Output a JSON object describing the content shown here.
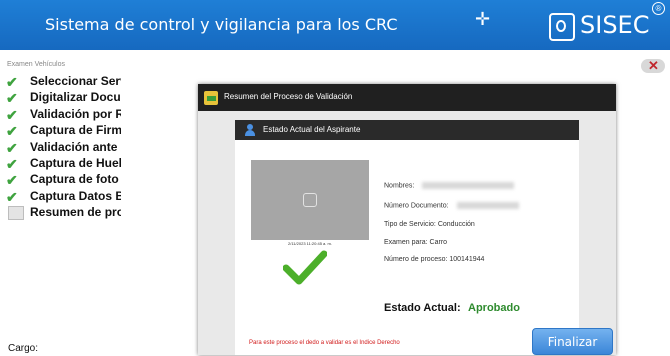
{
  "header": {
    "title": "Sistema de control y vigilancia para los CRC",
    "logo_text": "SISEC",
    "reg_mark": "®"
  },
  "main": {
    "section_label": "Examen Vehículos",
    "close_label": "✕",
    "steps": [
      {
        "label": "Seleccionar Serv",
        "status": "done"
      },
      {
        "label": "Digitalizar Docu",
        "status": "done"
      },
      {
        "label": "Validación por R",
        "status": "done"
      },
      {
        "label": "Captura de Firm",
        "status": "done"
      },
      {
        "label": "Validación ante",
        "status": "done"
      },
      {
        "label": "Captura de Huel",
        "status": "done"
      },
      {
        "label": "Captura de foto",
        "status": "done"
      },
      {
        "label": "Captura Datos B",
        "status": "done"
      },
      {
        "label": "Resumen de pro",
        "status": "pending"
      }
    ],
    "cargo_label": "Cargo:"
  },
  "dialog": {
    "title": "Resumen del Proceso de Validación",
    "card_title": "Estado Actual del Aspirante",
    "photo_caption": "2/11/2023 11:20:45 a. m.",
    "fields": {
      "nombres_label": "Nombres:",
      "numero_documento_label": "Número Documento:",
      "tipo_servicio_label": "Tipo de Servicio:",
      "tipo_servicio_value": "Conducción",
      "examen_label": "Examen para:",
      "examen_value": "Carro",
      "numero_proceso_label": "Número de proceso:",
      "numero_proceso_value": "100141944"
    },
    "estado_label": "Estado Actual:",
    "estado_value": "Aprobado",
    "warning": "Para este proceso el dedo a validar es el Indice Derecho"
  },
  "actions": {
    "finalizar_label": "Finalizar"
  },
  "colors": {
    "header_blue": "#1a73cc",
    "approved_green": "#2e8b2e",
    "warning_red": "#d11a1a",
    "button_blue": "#4a94e0"
  }
}
